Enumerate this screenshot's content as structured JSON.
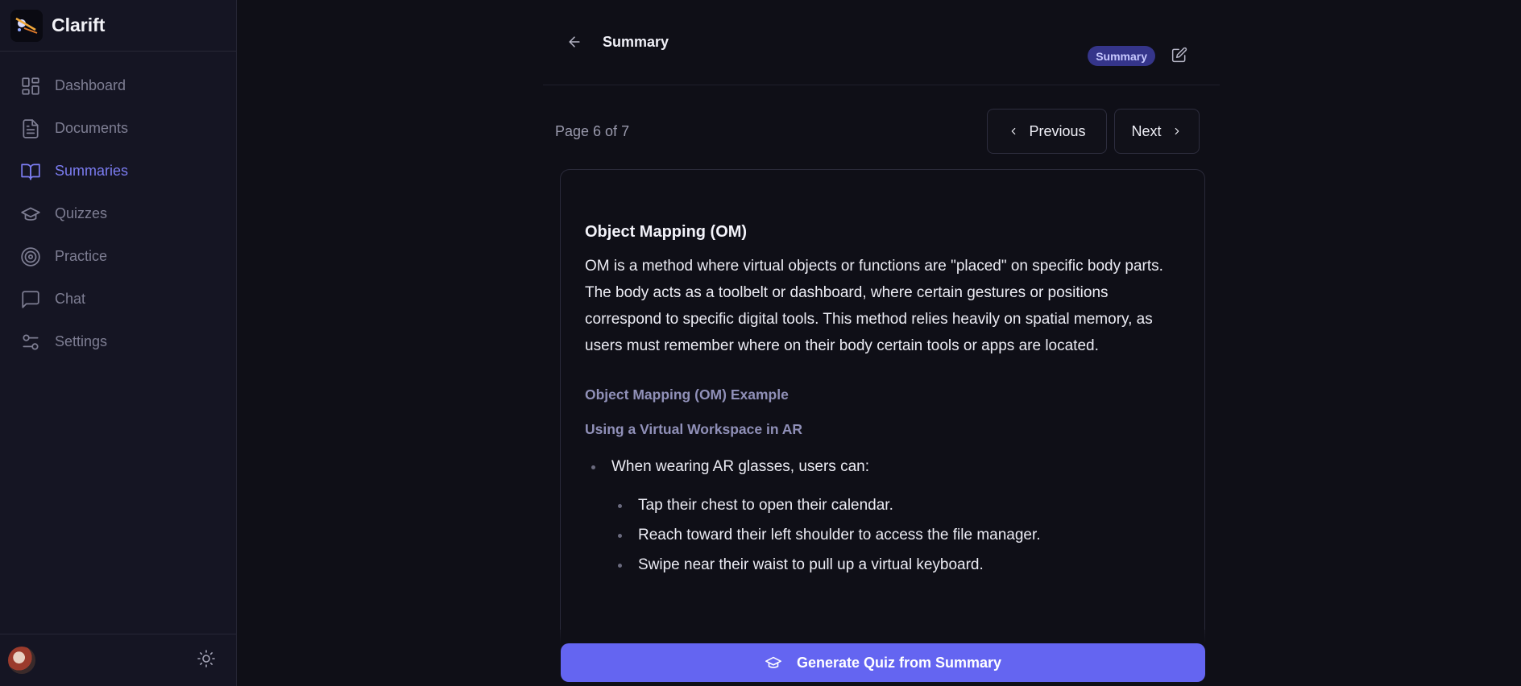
{
  "app": {
    "name": "Clarift"
  },
  "sidebar": {
    "items": [
      {
        "label": "Dashboard",
        "icon": "dashboard-icon",
        "active": false
      },
      {
        "label": "Documents",
        "icon": "document-icon",
        "active": false
      },
      {
        "label": "Summaries",
        "icon": "book-open-icon",
        "active": true
      },
      {
        "label": "Quizzes",
        "icon": "graduation-cap-icon",
        "active": false
      },
      {
        "label": "Practice",
        "icon": "target-icon",
        "active": false
      },
      {
        "label": "Chat",
        "icon": "chat-icon",
        "active": false
      },
      {
        "label": "Settings",
        "icon": "sliders-icon",
        "active": false
      }
    ]
  },
  "header": {
    "title": "Summary",
    "badge": "Summary"
  },
  "pager": {
    "info": "Page 6 of 7",
    "previous_label": "Previous",
    "next_label": "Next"
  },
  "content": {
    "title": "Object Mapping (OM)",
    "paragraph": "OM is a method where virtual objects or functions are \"placed\" on specific body parts. The body acts as a toolbelt or dashboard, where certain gestures or positions correspond to specific digital tools. This method relies heavily on spatial memory, as users must remember where on their body certain tools or apps are located.",
    "example_heading": "Object Mapping (OM) Example",
    "example_subheading": "Using a Virtual Workspace in AR",
    "list_item": "When wearing AR glasses, users can:",
    "sub_items": [
      "Tap their chest to open their calendar.",
      "Reach toward their left shoulder to access the file manager.",
      "Swipe near their waist to pull up a virtual keyboard."
    ]
  },
  "cta": {
    "label": "Generate Quiz from Summary"
  },
  "colors": {
    "accent": "#6465f1",
    "active_nav": "#7b7cf0",
    "badge_bg": "#35358a",
    "background": "#0f0f17",
    "sidebar_bg": "#151523"
  }
}
